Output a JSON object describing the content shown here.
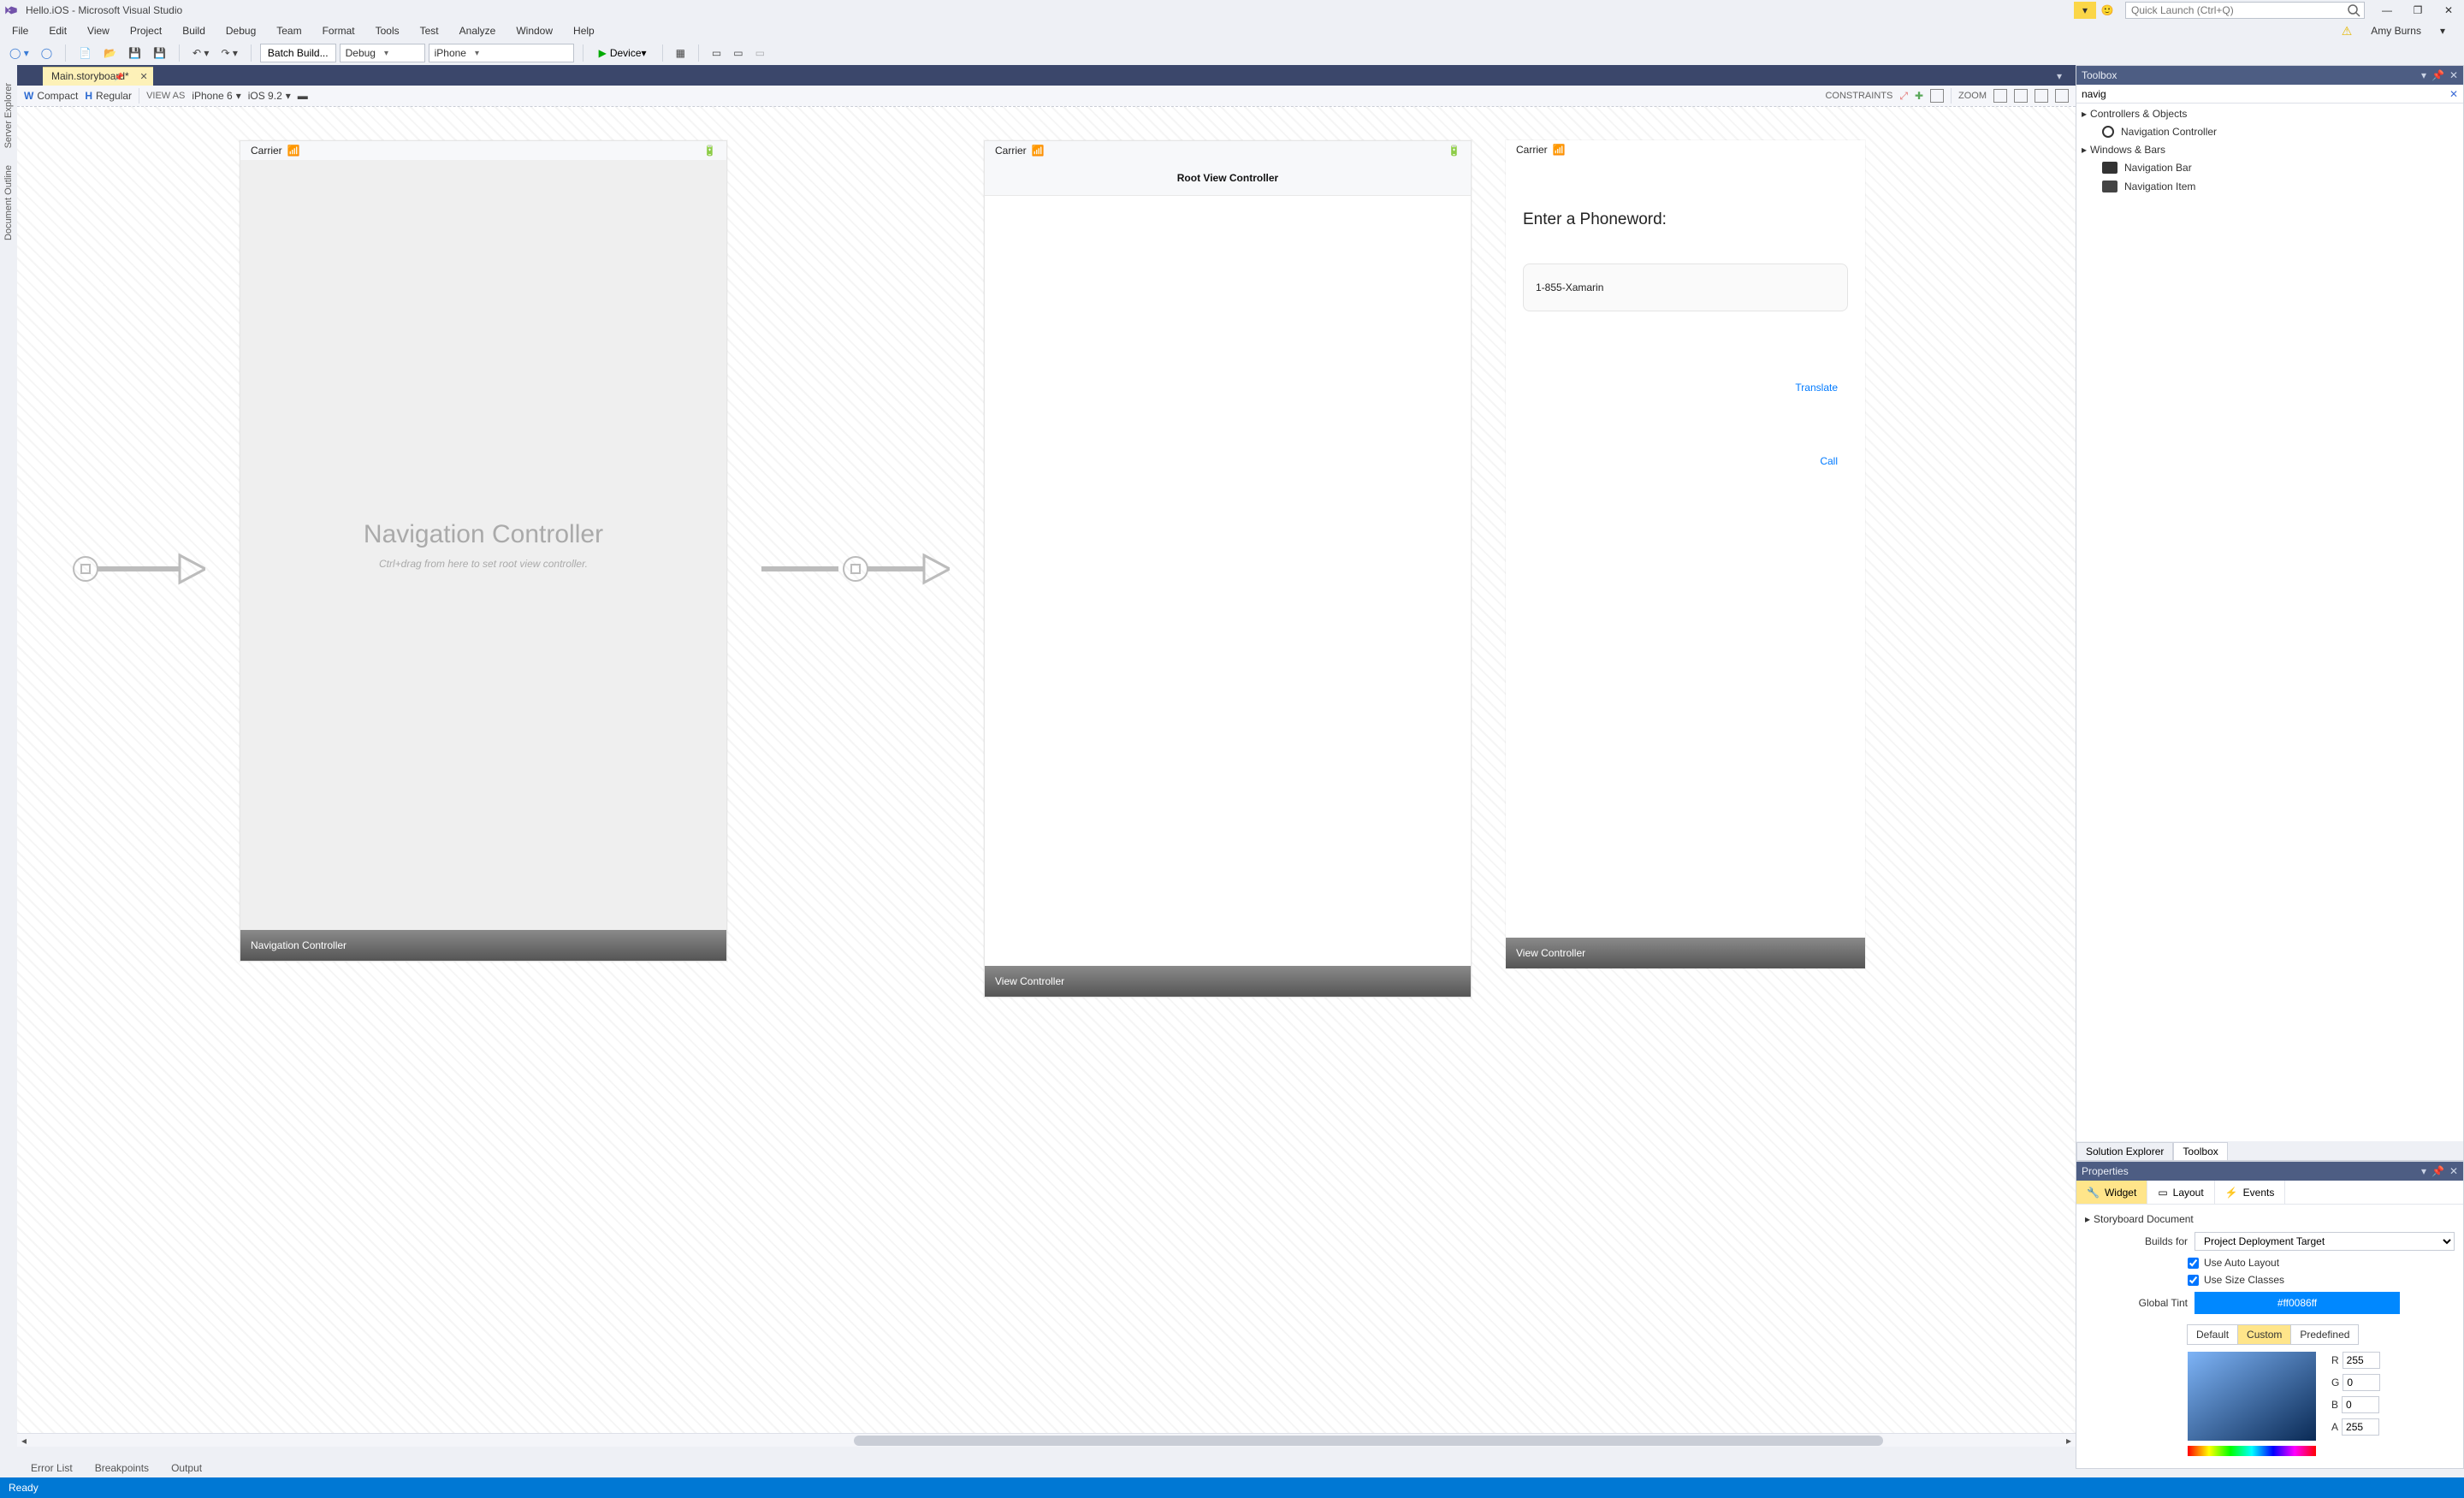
{
  "title": "Hello.iOS - Microsoft Visual Studio",
  "quick_launch_placeholder": "Quick Launch (Ctrl+Q)",
  "user_name": "Amy Burns",
  "menu": [
    "File",
    "Edit",
    "View",
    "Project",
    "Build",
    "Debug",
    "Team",
    "Format",
    "Tools",
    "Test",
    "Analyze",
    "Window",
    "Help"
  ],
  "toolbar": {
    "batch_build": "Batch Build...",
    "config": "Debug",
    "platform": "iPhone",
    "device": "Device"
  },
  "doc_tab": "Main.storyboard*",
  "leftrail": [
    "Server Explorer",
    "Document Outline"
  ],
  "editorbar": {
    "w": "W",
    "compact": "Compact",
    "h": "H",
    "regular": "Regular",
    "view_as": "VIEW AS",
    "device": "iPhone 6",
    "ios": "iOS 9.2",
    "constraints": "CONSTRAINTS",
    "zoom": "ZOOM"
  },
  "canvas": {
    "carrier": "Carrier",
    "nav_title": "Navigation Controller",
    "nav_sub": "Ctrl+drag from here to set root view controller.",
    "nav_label": "Navigation Controller",
    "root_title": "Root View Controller",
    "vc_label": "View Controller",
    "phoneword_prompt": "Enter a Phoneword:",
    "phoneword_value": "1-855-Xamarin",
    "translate": "Translate",
    "call": "Call",
    "vc_label2": "View Controller"
  },
  "toolbox": {
    "title": "Toolbox",
    "search": "navig",
    "group1": "Controllers & Objects",
    "item1": "Navigation Controller",
    "group2": "Windows & Bars",
    "item2": "Navigation Bar",
    "item3": "Navigation Item",
    "tab_solution": "Solution Explorer",
    "tab_toolbox": "Toolbox"
  },
  "properties": {
    "title": "Properties",
    "tab_widget": "Widget",
    "tab_layout": "Layout",
    "tab_events": "Events",
    "section": "Storyboard Document",
    "builds_for": "Builds for",
    "builds_for_value": "Project Deployment Target",
    "use_auto_layout": "Use Auto Layout",
    "use_size_classes": "Use Size Classes",
    "global_tint": "Global Tint",
    "tint_value": "#ff0086ff",
    "tab_default": "Default",
    "tab_custom": "Custom",
    "tab_predef": "Predefined",
    "R": "255",
    "G": "0",
    "B": "0",
    "A": "255"
  },
  "bottomtabs": [
    "Error List",
    "Breakpoints",
    "Output"
  ],
  "status": "Ready"
}
